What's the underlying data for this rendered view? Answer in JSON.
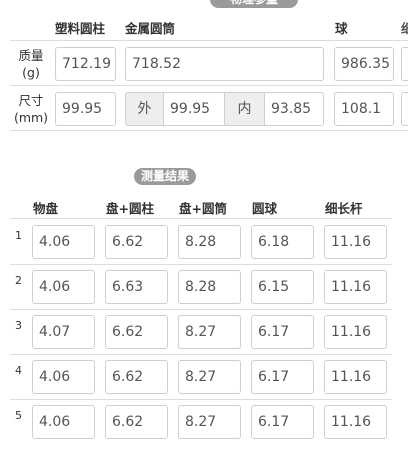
{
  "params": {
    "title": "物理参量",
    "columns": [
      "塑料圆柱",
      "金属圆筒",
      "球"
    ],
    "mass_label": "质量\n(g)",
    "size_label": "尺寸\n(mm)",
    "mass": {
      "plastic_cylinder": "712.19",
      "metal_tube": "718.52",
      "ball": "986.35"
    },
    "size": {
      "plastic_cylinder": "99.95",
      "outer_label": "外",
      "outer": "99.95",
      "inner_label": "内",
      "inner": "93.85",
      "ball": "108.1"
    }
  },
  "results": {
    "title": "测量结果",
    "columns": [
      "物盘",
      "盘+圆柱",
      "盘+圆筒",
      "圆球",
      "细长杆"
    ],
    "rows": [
      {
        "num": "1",
        "values": [
          "4.06",
          "6.62",
          "8.28",
          "6.18",
          "11.16"
        ]
      },
      {
        "num": "2",
        "values": [
          "4.06",
          "6.63",
          "8.28",
          "6.15",
          "11.16"
        ]
      },
      {
        "num": "3",
        "values": [
          "4.07",
          "6.62",
          "8.27",
          "6.17",
          "11.16"
        ]
      },
      {
        "num": "4",
        "values": [
          "4.06",
          "6.62",
          "8.27",
          "6.17",
          "11.16"
        ]
      },
      {
        "num": "5",
        "values": [
          "4.06",
          "6.62",
          "8.27",
          "6.17",
          "11.16"
        ]
      }
    ]
  }
}
